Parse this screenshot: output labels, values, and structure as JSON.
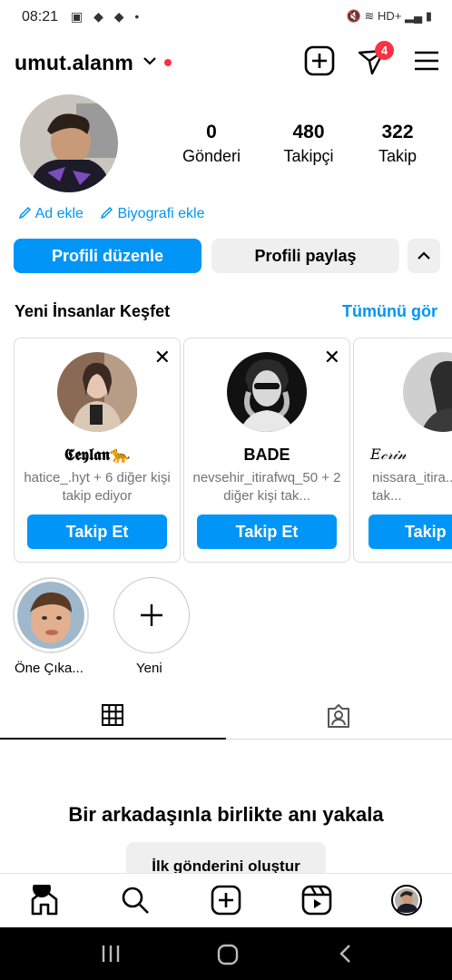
{
  "status_bar": {
    "time": "08:21",
    "left_icons": "▣ ◆ ◆ •",
    "right_icons": "🔇 ≋ HD+ ▂▄ ▮"
  },
  "header": {
    "username": "umut.alanm",
    "chevron": "⌄",
    "activity_badge": "4",
    "icons": [
      "add-post-icon",
      "messenger-icon",
      "menu-icon"
    ]
  },
  "profile": {
    "stats": [
      {
        "value": "0",
        "label": "Gönderi"
      },
      {
        "value": "480",
        "label": "Takipçi"
      },
      {
        "value": "322",
        "label": "Takip"
      }
    ],
    "add_name": "Ad ekle",
    "add_bio": "Biyografi ekle",
    "edit_profile": "Profili düzenle",
    "share_profile": "Profili paylaş"
  },
  "discover": {
    "title": "Yeni İnsanlar Keşfet",
    "see_all": "Tümünü gör",
    "cards": [
      {
        "name": "𝕮𝖊𝖞𝖑𝖆𝖓🐆",
        "subtitle": "hatice_.hyt + 6 diğer kişi takip ediyor",
        "button": "Takip Et"
      },
      {
        "name": "BADE",
        "subtitle": "nevsehir_itirafwq_50 + 2 diğer kişi tak...",
        "button": "Takip Et"
      },
      {
        "name": "𝐸𝒸𝓇𝒾𝓃",
        "subtitle": "nissara_itira... diğer kişi tak...",
        "button": "Takip"
      }
    ]
  },
  "highlights": [
    {
      "label": "Öne Çıka..."
    },
    {
      "label": "Yeni"
    }
  ],
  "empty_state": {
    "title": "Bir arkadaşınla birlikte anı yakala",
    "button": "İlk gönderini oluştur"
  },
  "colors": {
    "accent": "#0095f6",
    "badge": "#ff3040",
    "button_gray": "#efefef"
  }
}
